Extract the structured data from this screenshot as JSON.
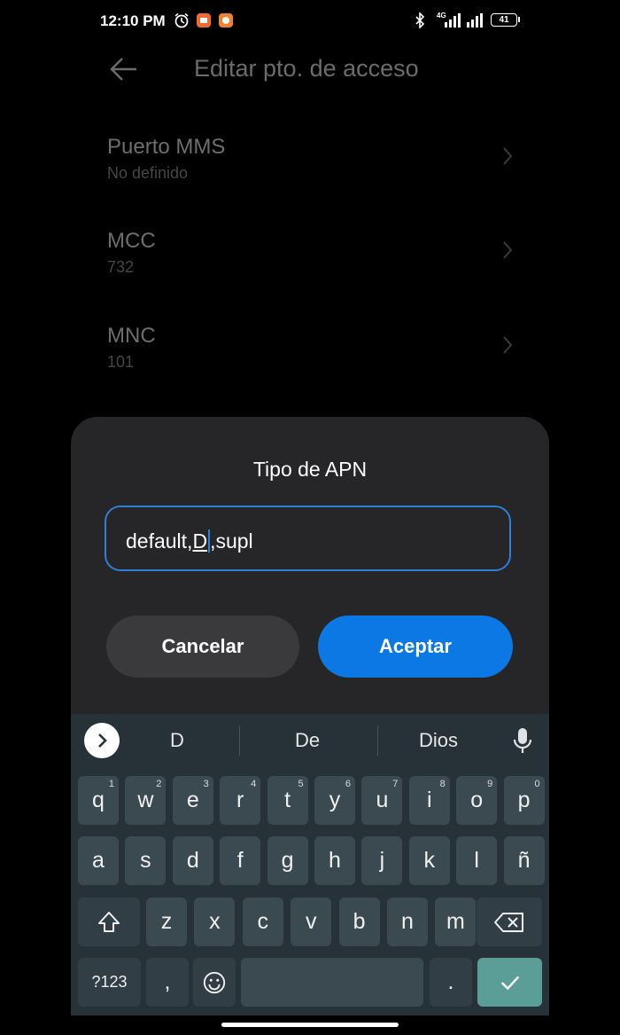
{
  "status": {
    "time": "12:10 PM",
    "network": "4G",
    "battery": "41",
    "icons": [
      "alarm-icon",
      "app-notification-icon",
      "app-notification-icon",
      "bluetooth-icon",
      "signal-4g-icon",
      "signal-icon",
      "battery-icon"
    ]
  },
  "header": {
    "title": "Editar pto. de acceso"
  },
  "settings": [
    {
      "label": "Puerto MMS",
      "value": "No definido"
    },
    {
      "label": "MCC",
      "value": "732"
    },
    {
      "label": "MNC",
      "value": "101"
    }
  ],
  "dialog": {
    "title": "Tipo de APN",
    "field": {
      "before": "default,",
      "composing": "D",
      "after": ",supl"
    },
    "cancel_label": "Cancelar",
    "ok_label": "Aceptar"
  },
  "keyboard": {
    "suggestions": [
      "D",
      "De",
      "Dios"
    ],
    "row1": [
      {
        "k": "q",
        "h": "1"
      },
      {
        "k": "w",
        "h": "2"
      },
      {
        "k": "e",
        "h": "3"
      },
      {
        "k": "r",
        "h": "4"
      },
      {
        "k": "t",
        "h": "5"
      },
      {
        "k": "y",
        "h": "6"
      },
      {
        "k": "u",
        "h": "7"
      },
      {
        "k": "i",
        "h": "8"
      },
      {
        "k": "o",
        "h": "9"
      },
      {
        "k": "p",
        "h": "0"
      }
    ],
    "row2": [
      "a",
      "s",
      "d",
      "f",
      "g",
      "h",
      "j",
      "k",
      "l",
      "ñ"
    ],
    "row3": [
      "z",
      "x",
      "c",
      "v",
      "b",
      "n",
      "m"
    ],
    "symbols_label": "?123",
    "comma_label": ",",
    "period_label": "."
  },
  "colors": {
    "accent": "#0b78e3",
    "keyboard_bg": "#263238",
    "key_bg": "#3b4a51",
    "enter_bg": "#5b9e97"
  }
}
